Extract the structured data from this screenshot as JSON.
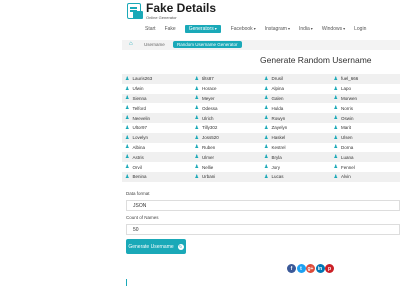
{
  "header": {
    "logo_title": "Fake Details",
    "logo_subtitle": "Online Generator",
    "nav": [
      {
        "label": "Start",
        "active": false
      },
      {
        "label": "Fake",
        "active": false
      },
      {
        "label": "Generators",
        "active": true,
        "dropdown": true
      },
      {
        "label": "Facebook",
        "active": false,
        "dropdown": true
      },
      {
        "label": "Instagram",
        "active": false,
        "dropdown": true
      },
      {
        "label": "India",
        "active": false,
        "dropdown": true
      },
      {
        "label": "Windows",
        "active": false,
        "dropdown": true
      },
      {
        "label": "Login",
        "active": false
      }
    ]
  },
  "breadcrumb": {
    "home_icon": "home-icon",
    "link": "Username",
    "active": "Random Username Generator"
  },
  "main": {
    "title": "Generate Random Username",
    "usernames": [
      [
        "Lauris263",
        "tilts87",
        "Drusil",
        "fuel_666"
      ],
      [
        "Ulwin",
        "Horace",
        "Alpina",
        "Lapo"
      ],
      [
        "Sienna",
        "Meyer",
        "Galen",
        "Morwen"
      ],
      [
        "Telford",
        "Odessa",
        "Hulda",
        "Norris"
      ],
      [
        "Neevelin",
        "Ulrich",
        "Rowyn",
        "Oswin"
      ],
      [
        "Ultor97",
        "Tilly302",
        "Zayelyn",
        "Marit"
      ],
      [
        "Lovelyn",
        "Joss520",
        "Haskel",
        "Ulsen"
      ],
      [
        "Albina",
        "Ruben",
        "Kestrel",
        "Dorna"
      ],
      [
        "Astris",
        "Ulmer",
        "Bryla",
        "Luana"
      ],
      [
        "Orvil",
        "Nellie",
        "Jory",
        "Fennel"
      ],
      [
        "Benina",
        "Urbani",
        "Lucas",
        "Alvin"
      ]
    ],
    "user_icon": "user-icon",
    "format_label": "Data format",
    "format_value": "JSON",
    "count_label": "Count of Names",
    "count_value": "50",
    "generate_button": "Generate Username",
    "generate_icon": "refresh-icon"
  },
  "share": {
    "buttons": [
      {
        "name": "facebook-icon",
        "glyph": "f",
        "color": "#3b5998"
      },
      {
        "name": "twitter-icon",
        "glyph": "t",
        "color": "#1da1f2"
      },
      {
        "name": "google-plus-icon",
        "glyph": "g+",
        "color": "#dd4b39"
      },
      {
        "name": "linkedin-icon",
        "glyph": "in",
        "color": "#0077b5"
      },
      {
        "name": "pinterest-icon",
        "glyph": "p",
        "color": "#cb2027"
      }
    ]
  },
  "colors": {
    "accent": "#1aa9b8"
  }
}
